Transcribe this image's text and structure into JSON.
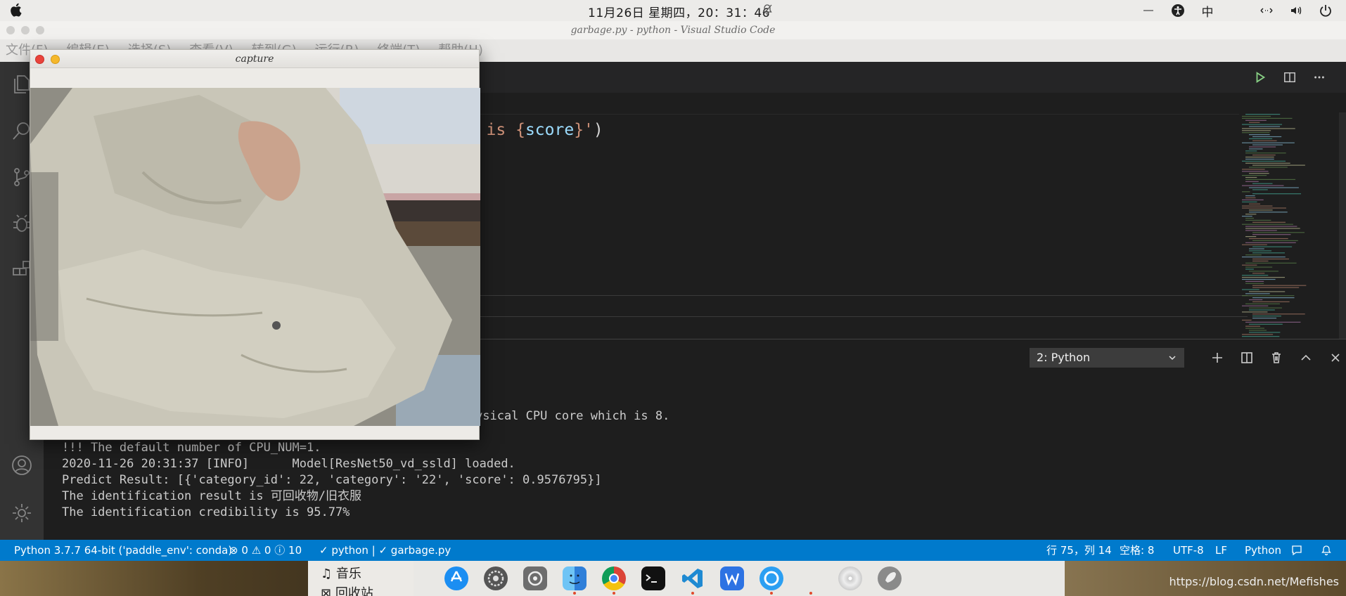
{
  "menubar": {
    "clock": "11月26日 星期四，20：31：46",
    "input_method": "中"
  },
  "vscode": {
    "window_title": "garbage.py - python - Visual Studio Code",
    "menu_items": [
      "文件(F)",
      "编辑(E)",
      "选择(S)",
      "查看(V)",
      "转到(G)",
      "运行(R)",
      "终端(T)",
      "帮助(H)"
    ],
    "code_line": {
      "a": "ty is {",
      "var": "score",
      "b": "}'",
      "c": ")"
    }
  },
  "panel": {
    "terminal_select": "2: Python",
    "lines": {
      "l1": "ysical CPU core which is 8.",
      "l2": "!!! The default number of CPU_NUM=1.",
      "l3": "2020-11-26 20:31:37 [INFO]      Model[ResNet50_vd_ssld] loaded.",
      "l4": "Predict Result: [{'category_id': 22, 'category': '22', 'score': 0.9576795}]",
      "l5": "The identification result is 可回收物/旧衣服",
      "l6": "The identification credibility is 95.77%"
    }
  },
  "statusbar": {
    "interpreter": "Python 3.7.7 64-bit ('paddle_env': conda)",
    "errors": "0",
    "warnings": "0",
    "infos": "10",
    "check1": "python",
    "check2": "garbage.py",
    "position": "行 75，列 14",
    "spaces": "空格: 8",
    "encoding": "UTF-8",
    "eol": "LF",
    "language": "Python"
  },
  "capture": {
    "title": "capture"
  },
  "dock": {
    "music_label": "音乐",
    "trash_label": "回收站"
  },
  "watermark": "https://blog.csdn.net/Mefishes",
  "colors": {
    "statusbar": "#007acc",
    "editor_bg": "#1e1e1e",
    "close": "#e9433b",
    "minimize": "#f5b82b"
  }
}
